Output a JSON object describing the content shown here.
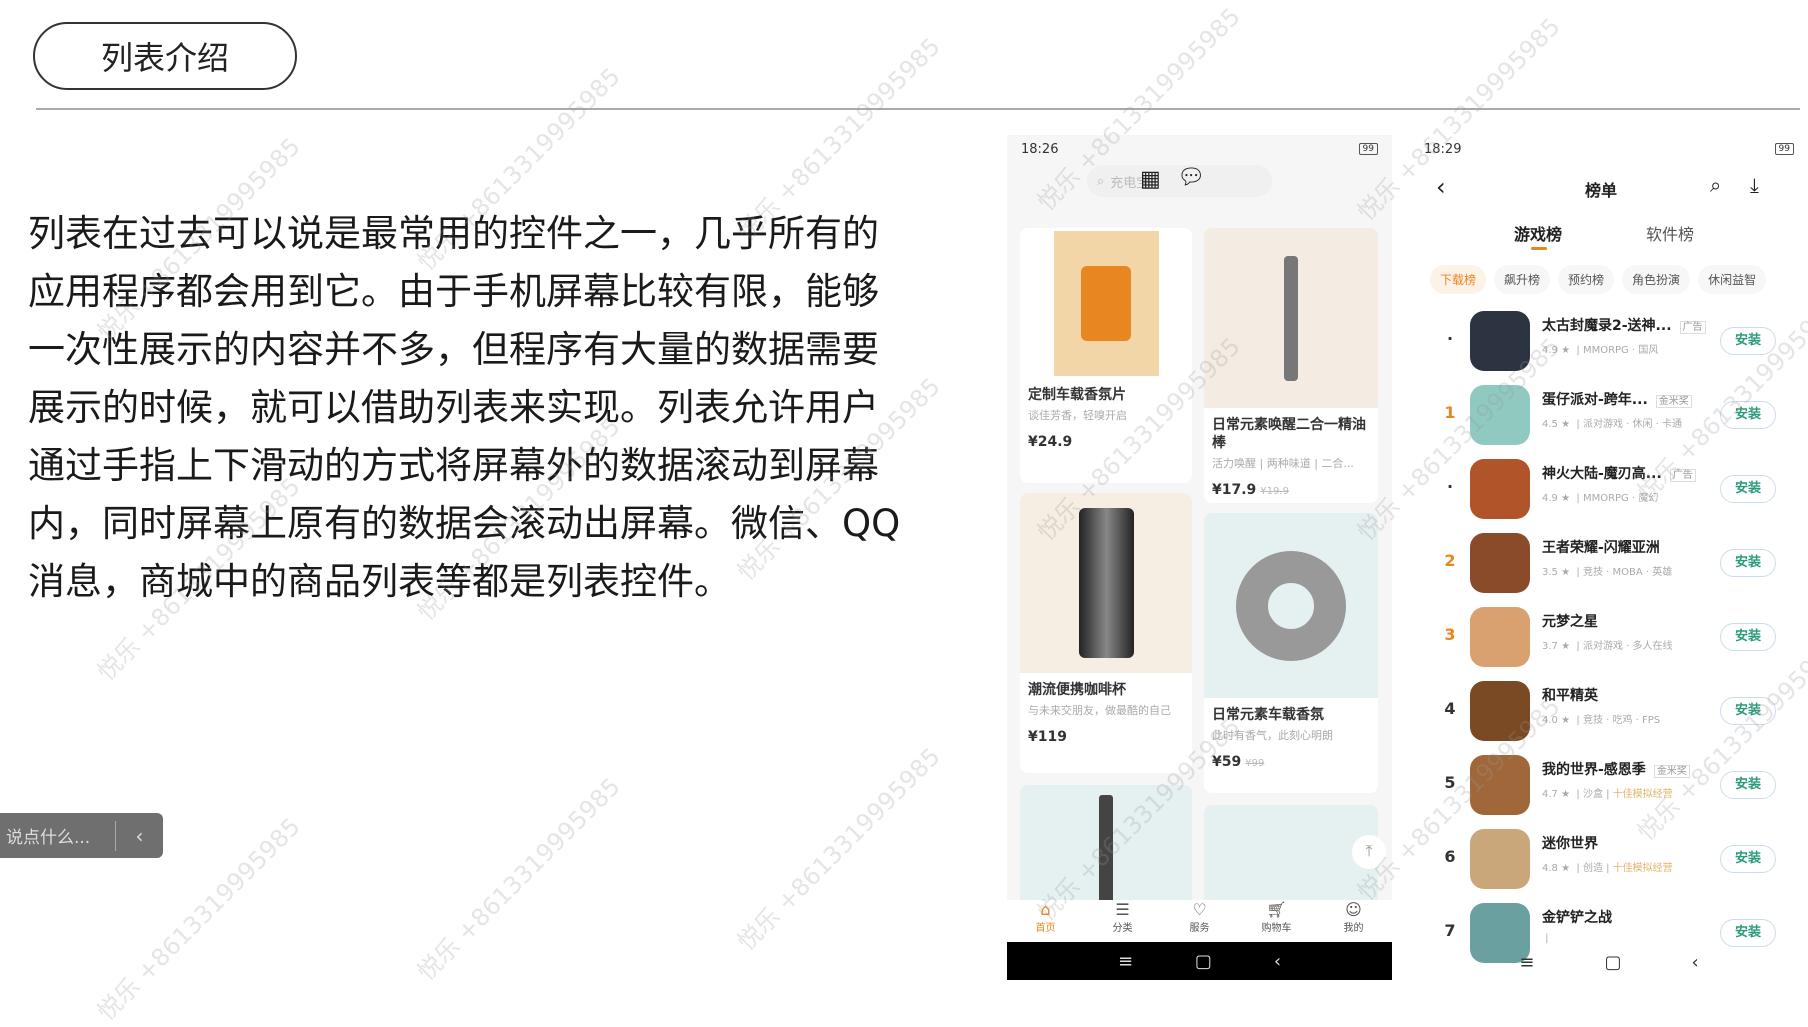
{
  "slide": {
    "title": "列表介绍",
    "paragraph_lines": [
      "列表在过去可以说是最常用的控件之一，几乎所有的",
      "应用程序都会用到它。由于手机屏幕比较有限，能够",
      "一次性展示的内容并不多，但程序有大量的数据需要",
      "展示的时候，就可以借助列表来实现。列表允许用户",
      "通过手指上下滑动的方式将屏幕外的数据滚动到屏幕",
      "内，同时屏幕上原有的数据会滚动出屏幕。微信、QQ",
      "消息，商城中的商品列表等都是列表控件。"
    ],
    "comment_placeholder": "说点什么...",
    "comment_toggle": "‹",
    "watermark": "悦乐 +8613319995985"
  },
  "phone1": {
    "time": "18:26",
    "battery": "99",
    "search_placeholder": "充电宝",
    "products": [
      {
        "name": "定制车载香氛片",
        "desc": "谈佳芳香，轻嗅开启",
        "price": "¥24.9",
        "old_price": ""
      },
      {
        "name": "日常元素唤醒二合一精油棒",
        "desc": "活力唤醒 | 两种味道 | 二合...",
        "price": "¥17.9",
        "old_price": "¥19.9"
      },
      {
        "name": "潮流便携咖啡杯",
        "desc": "与未来交朋友，做最酷的自己",
        "price": "¥119",
        "old_price": ""
      },
      {
        "name": "日常元素车载香氛",
        "desc": "此时有香气，此刻心明朗",
        "price": "¥59",
        "old_price": "¥99"
      }
    ],
    "tabs": [
      "首页",
      "分类",
      "服务",
      "购物车",
      "我的"
    ],
    "accent": "#e8861f"
  },
  "phone2": {
    "time": "18:29",
    "battery": "99",
    "title": "榜单",
    "main_tabs": [
      "游戏榜",
      "软件榜"
    ],
    "chips": [
      "下载榜",
      "飙升榜",
      "预约榜",
      "角色扮演",
      "休闲益智"
    ],
    "install_label": "安装",
    "games": [
      {
        "rank": "·",
        "name": "太古封魔录2-送神...",
        "tag": "广告",
        "rating": "4.9 ★",
        "meta": "MMORPG · 国风",
        "highlight": ""
      },
      {
        "rank": "1",
        "name": "蛋仔派对-跨年...",
        "tag": "金米奖",
        "rating": "4.5 ★",
        "meta": "派对游戏 · 休闲 · 卡通",
        "highlight": ""
      },
      {
        "rank": "·",
        "name": "神火大陆-魔刃高...",
        "tag": "广告",
        "rating": "4.9 ★",
        "meta": "MMORPG · 魔幻",
        "highlight": ""
      },
      {
        "rank": "2",
        "name": "王者荣耀-闪耀亚洲",
        "tag": "",
        "rating": "3.5 ★",
        "meta": "竞技 · MOBA · 英雄",
        "highlight": ""
      },
      {
        "rank": "3",
        "name": "元梦之星",
        "tag": "",
        "rating": "3.7 ★",
        "meta": "派对游戏 · 多人在线",
        "highlight": ""
      },
      {
        "rank": "4",
        "name": "和平精英",
        "tag": "",
        "rating": "4.0 ★",
        "meta": "竞技 · 吃鸡 · FPS",
        "highlight": ""
      },
      {
        "rank": "5",
        "name": "我的世界-感恩季",
        "tag": "金米奖",
        "rating": "4.7 ★",
        "meta": "沙盒",
        "highlight": "十佳模拟经营"
      },
      {
        "rank": "6",
        "name": "迷你世界",
        "tag": "",
        "rating": "4.8 ★",
        "meta": "创造",
        "highlight": "十佳模拟经营"
      },
      {
        "rank": "7",
        "name": "金铲铲之战",
        "tag": "",
        "rating": "",
        "meta": "",
        "highlight": ""
      }
    ],
    "rank_color": "#e8861f",
    "install_color": "#2a9b7a"
  }
}
